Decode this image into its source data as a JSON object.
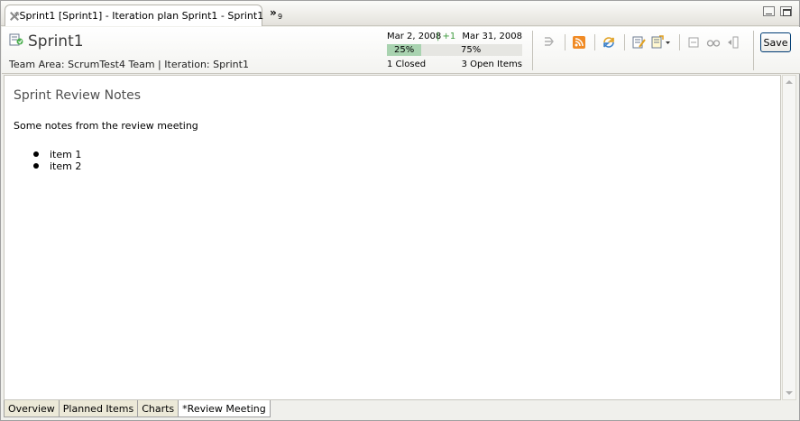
{
  "window": {
    "tab_title": "*Sprint1 [Sprint1] - Iteration plan Sprint1 - Sprint1",
    "overflow_label": "»",
    "overflow_count": "9"
  },
  "header": {
    "title": "Sprint1",
    "team_line": "Team Area: ScrumTest4 Team  |  Iteration: Sprint1",
    "progress": {
      "start_date": "Mar 2, 2008",
      "delta": "| +1",
      "end_date": "Mar 31, 2008",
      "left_pct_label": "25%",
      "right_pct_label": "75%",
      "fill_fraction": 0.25,
      "closed": "1 Closed",
      "open": "3 Open Items"
    },
    "save_label": "Save"
  },
  "toolbar": {
    "icons": [
      "branch-icon",
      "feed-icon",
      "refresh-icon",
      "edit-icon",
      "note-dropdown-icon",
      "collapse-icon",
      "glasses-icon",
      "panel-icon"
    ]
  },
  "content": {
    "section_title": "Sprint Review Notes",
    "notes": "Some notes from the review meeting",
    "items": [
      "item 1",
      "item 2"
    ]
  },
  "bottom_tabs": [
    {
      "label": "Overview",
      "active": false
    },
    {
      "label": "Planned Items",
      "active": false
    },
    {
      "label": "Charts",
      "active": false
    },
    {
      "label": "*Review Meeting",
      "active": true
    }
  ],
  "colors": {
    "progress_fill": "#a9d3b0",
    "feed_orange": "#f08a24",
    "save_border": "#003c74"
  }
}
